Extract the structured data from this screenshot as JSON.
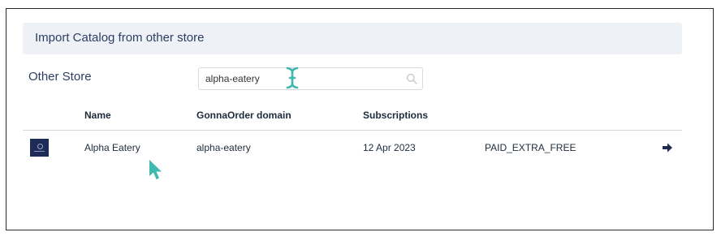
{
  "panel": {
    "title": "Import Catalog from other store"
  },
  "filter": {
    "label": "Other Store",
    "search_value": "alpha-eatery"
  },
  "table": {
    "headers": [
      "Name",
      "GonnaOrder domain",
      "Subscriptions"
    ],
    "rows": [
      {
        "name": "Alpha Eatery",
        "domain": "alpha-eatery",
        "subscription_date": "12 Apr 2023",
        "plan": "PAID_EXTRA_FREE"
      }
    ]
  },
  "icons": {
    "search": "search-icon",
    "go": "arrow-right-icon",
    "cursor": "mouse-pointer",
    "text_cursor": "text-cursor"
  },
  "colors": {
    "accent": "#2c3e63",
    "cursor": "#3fb8b0",
    "thumbnail": "#1f2b57"
  }
}
